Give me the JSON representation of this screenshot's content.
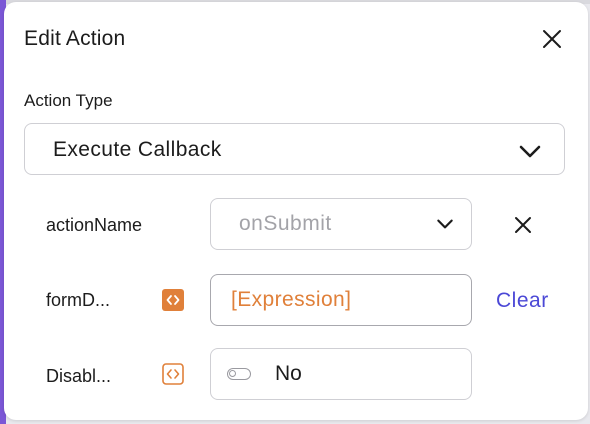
{
  "dialog": {
    "title": "Edit Action",
    "close_icon": "close-icon"
  },
  "action_type": {
    "label": "Action Type",
    "selected": "Execute Callback",
    "icon": "chevron-down-icon"
  },
  "params": [
    {
      "label": "actionName",
      "value": "onSubmit",
      "icon": "chevron-down-icon",
      "remove_icon": "close-icon"
    },
    {
      "label": "formD...",
      "value": "[Expression]",
      "expression_icon": "code-brackets-icon",
      "clear_label": "Clear"
    },
    {
      "label": "Disabl...",
      "value": "No",
      "expression_icon": "code-brackets-icon",
      "toggle_on": false
    }
  ],
  "colors": {
    "accent": "#4b48d6",
    "expression": "#e0803a",
    "sidebar_edge": "#7b57d6"
  }
}
